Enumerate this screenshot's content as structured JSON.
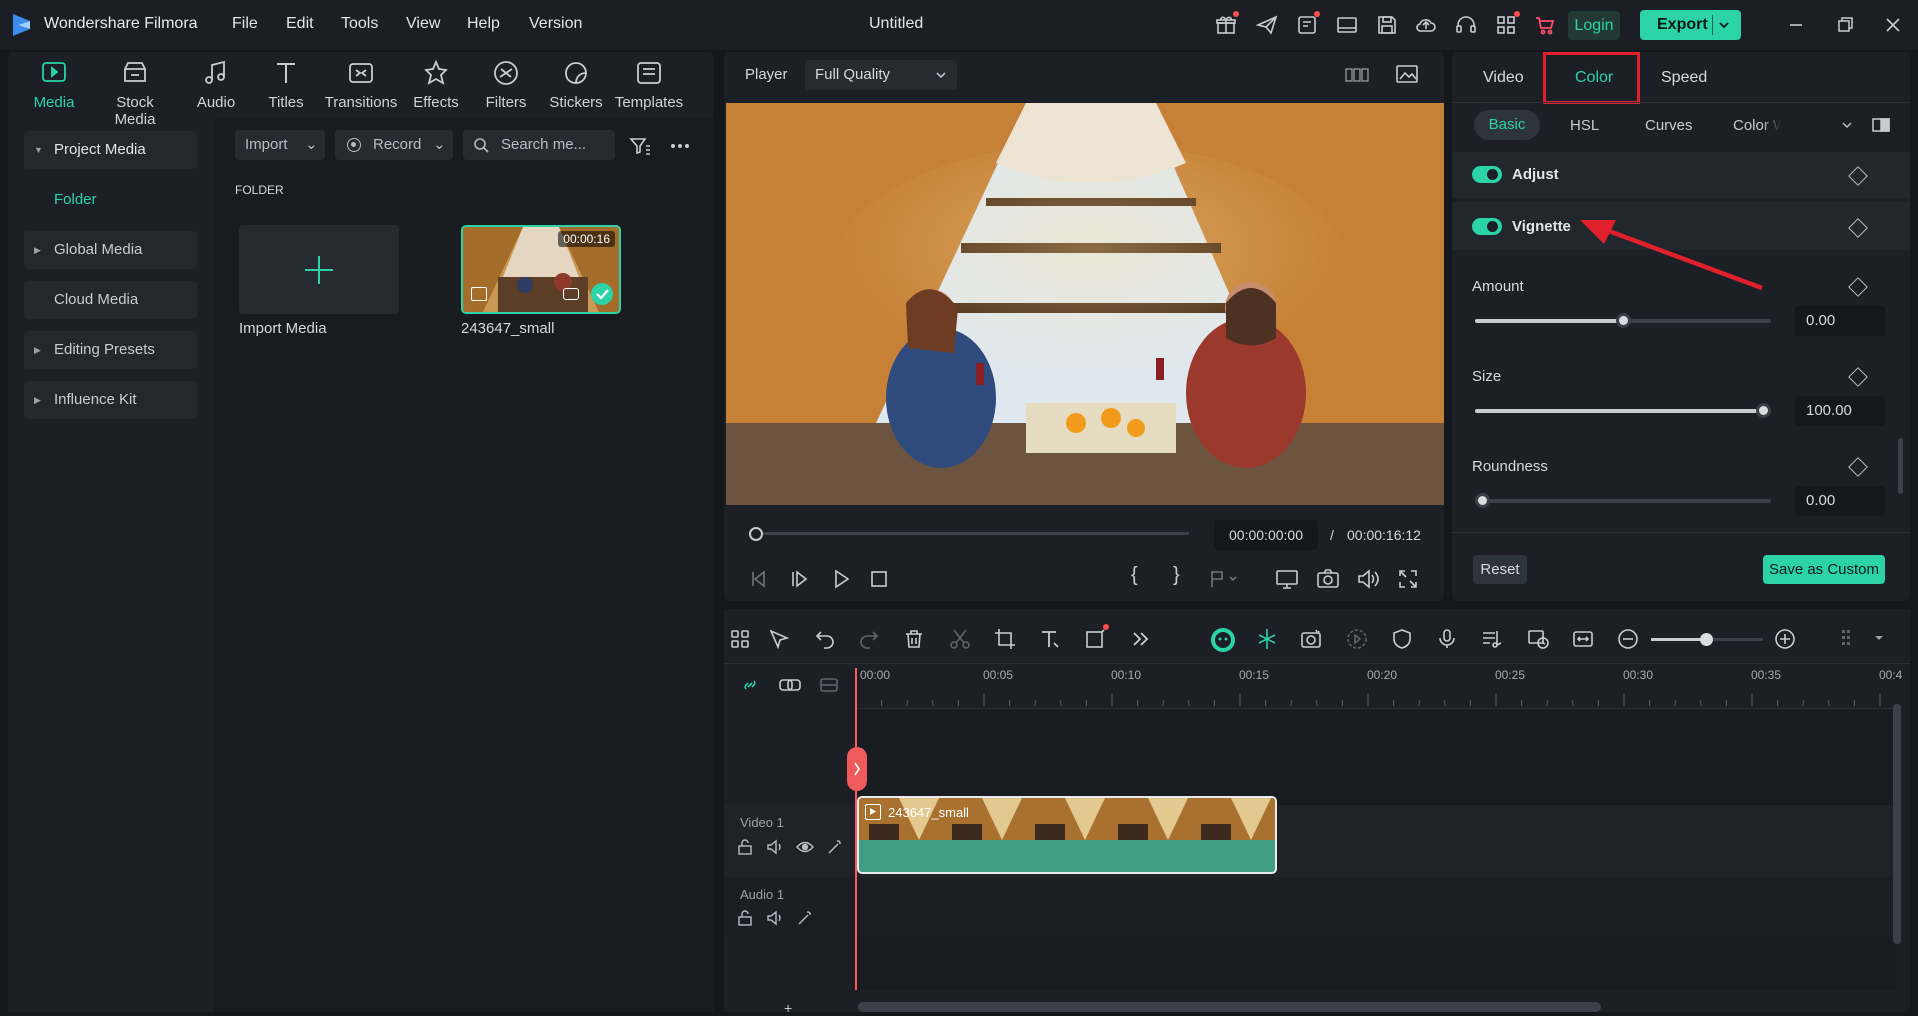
{
  "app": {
    "name": "Wondershare Filmora",
    "doc_title": "Untitled",
    "login": "Login",
    "export": "Export"
  },
  "menu": [
    "File",
    "Edit",
    "Tools",
    "View",
    "Help",
    "Version"
  ],
  "media_tabs": [
    {
      "label": "Media",
      "icon": "media-icon"
    },
    {
      "label": "Stock Media",
      "icon": "stock-media-icon"
    },
    {
      "label": "Audio",
      "icon": "audio-icon"
    },
    {
      "label": "Titles",
      "icon": "titles-icon"
    },
    {
      "label": "Transitions",
      "icon": "transitions-icon"
    },
    {
      "label": "Effects",
      "icon": "effects-icon"
    },
    {
      "label": "Filters",
      "icon": "filters-icon"
    },
    {
      "label": "Stickers",
      "icon": "stickers-icon"
    },
    {
      "label": "Templates",
      "icon": "templates-icon"
    }
  ],
  "sidebar": {
    "project_media": "Project Media",
    "folder": "Folder",
    "global_media": "Global Media",
    "cloud_media": "Cloud Media",
    "editing_presets": "Editing Presets",
    "influence_kit": "Influence Kit"
  },
  "media": {
    "import": "Import",
    "record": "Record",
    "search_placeholder": "Search me...",
    "folder_heading": "FOLDER",
    "import_media": "Import Media",
    "clip_name": "243647_small",
    "clip_duration": "00:00:16"
  },
  "player": {
    "label": "Player",
    "quality": "Full Quality",
    "current_time": "00:00:00:00",
    "separator": "/",
    "total_time": "00:00:16:12",
    "progress": 0
  },
  "properties": {
    "tabs": [
      "Video",
      "Color",
      "Speed"
    ],
    "active_tab": "Color",
    "subtabs": [
      "Basic",
      "HSL",
      "Curves",
      "Color W"
    ],
    "active_subtab": "Basic",
    "adjust": "Adjust",
    "vignette": "Vignette",
    "amount_label": "Amount",
    "amount_value": "0.00",
    "amount_fraction": 0.5,
    "size_label": "Size",
    "size_value": "100.00",
    "size_fraction": 1.0,
    "roundness_label": "Roundness",
    "roundness_value": "0.00",
    "roundness_fraction": 0.0,
    "reset": "Reset",
    "save_custom": "Save as Custom"
  },
  "timeline": {
    "ruler": [
      "00:00",
      "00:05",
      "00:10",
      "00:15",
      "00:20",
      "00:25",
      "00:30",
      "00:35",
      "00:4"
    ],
    "video_track": "Video 1",
    "audio_track": "Audio 1",
    "clip_name": "243647_small",
    "add": "+"
  },
  "colors": {
    "accent": "#2bd3a7",
    "highlight": "#e0202a",
    "background": "#14171c",
    "panel": "#1c1f25"
  }
}
